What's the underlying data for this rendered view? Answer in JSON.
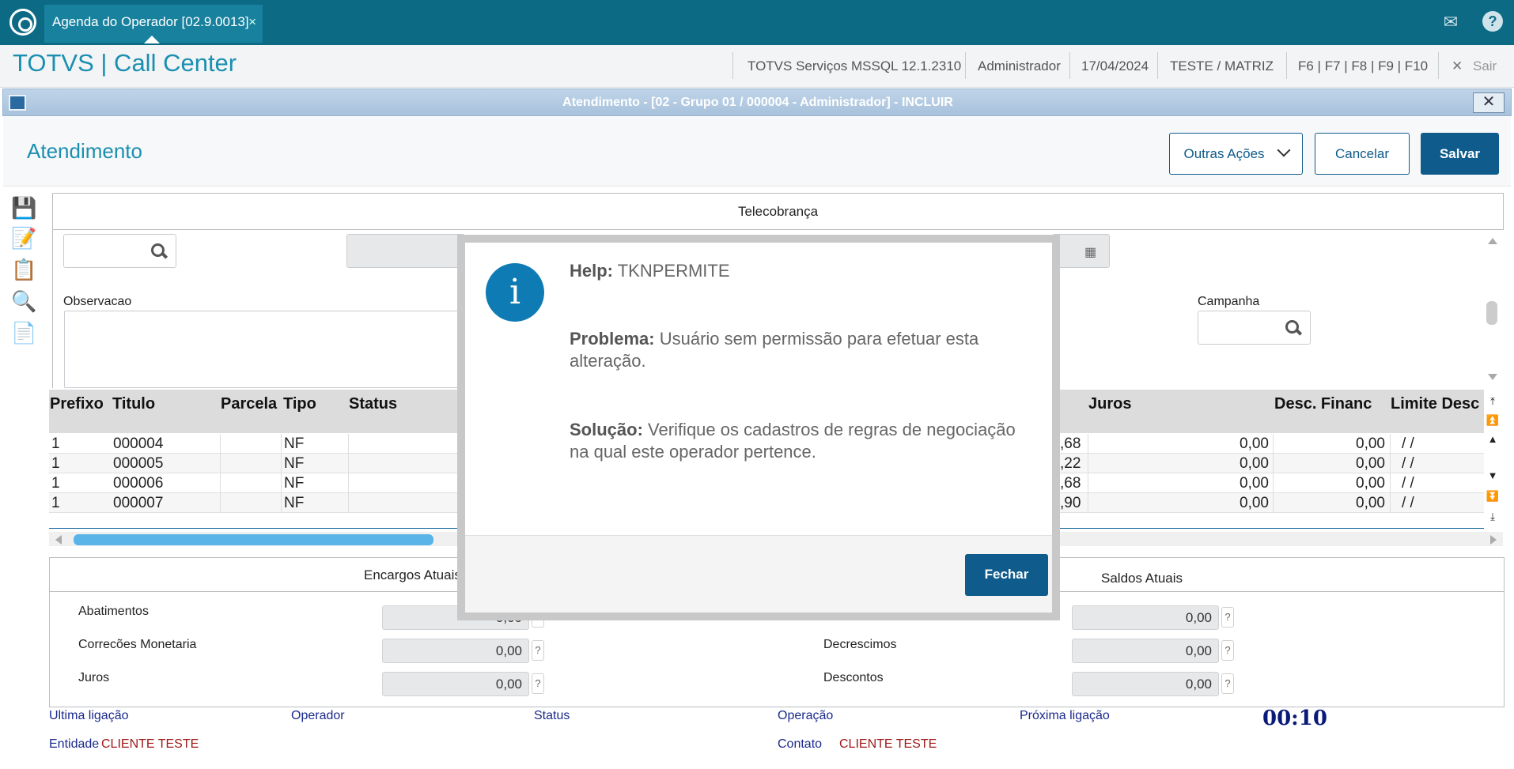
{
  "topbar": {
    "tab_label": "Agenda do Operador [02.9.0013]",
    "tab_close": "×",
    "mail_icon": "✉",
    "help_icon": "?"
  },
  "header": {
    "brand": "TOTVS | Call Center",
    "env": "TOTVS Serviços MSSQL 12.1.2310",
    "user": "Administrador",
    "date": "17/04/2024",
    "company": "TESTE / MATRIZ",
    "keys": "F6 | F7 | F8 | F9 | F10",
    "exit_icon": "✕",
    "exit_label": "Sair"
  },
  "window": {
    "title": "Atendimento - [02 - Grupo 01 / 000004 - Administrador] - INCLUIR",
    "close": "✕"
  },
  "page": {
    "title": "Atendimento",
    "other_actions": "Outras Ações",
    "cancel": "Cancelar",
    "save": "Salvar"
  },
  "panel": {
    "title": "Telecobrança",
    "observacao_label": "Observacao",
    "campanha_label": "Campanha"
  },
  "grid": {
    "headers": [
      "Prefixo",
      "Titulo",
      "Parcela",
      "Tipo",
      "Status",
      "Juros",
      "Desc. Financ",
      "Limite Desc"
    ],
    "rows": [
      {
        "prefixo": "1",
        "titulo": "000004",
        "tipo": "NF",
        "valor": ",68",
        "juros": "0,00",
        "desc": "0,00",
        "limite": "/ /"
      },
      {
        "prefixo": "1",
        "titulo": "000005",
        "tipo": "NF",
        "valor": ",22",
        "juros": "0,00",
        "desc": "0,00",
        "limite": "/ /"
      },
      {
        "prefixo": "1",
        "titulo": "000006",
        "tipo": "NF",
        "valor": ",68",
        "juros": "0,00",
        "desc": "0,00",
        "limite": "/ /"
      },
      {
        "prefixo": "1",
        "titulo": "000007",
        "tipo": "NF",
        "valor": ",90",
        "juros": "0,00",
        "desc": "0,00",
        "limite": "/ /"
      }
    ]
  },
  "bottom": {
    "encargos_tab": "Encargos Atuais",
    "saldos_tab": "Saldos Atuais",
    "left_fields": [
      {
        "label": "Abatimentos",
        "value": "0,00"
      },
      {
        "label": "Correcões Monetaria",
        "value": "0,00"
      },
      {
        "label": "Juros",
        "value": "0,00"
      }
    ],
    "right_fields": [
      {
        "label": "",
        "value": "0,00"
      },
      {
        "label": "Decrescimos",
        "value": "0,00"
      },
      {
        "label": "Descontos",
        "value": "0,00"
      }
    ],
    "qmark": "?"
  },
  "footer": {
    "ultima": "Ultima ligação",
    "operador": "Operador",
    "status": "Status",
    "operacao": "Operação",
    "proxima": "Próxima ligação",
    "timer": "00:10",
    "entidade_label": "Entidade",
    "entidade_value": "CLIENTE TESTE",
    "contato_label": "Contato",
    "contato_value": "CLIENTE TESTE"
  },
  "modal": {
    "icon": "i",
    "help_label": "Help:",
    "help_value": "TKNPERMITE",
    "problema_label": "Problema:",
    "problema_value": "Usuário sem permissão para efetuar esta alteração.",
    "solucao_label": "Solução:",
    "solucao_value": "Verifique os cadastros de regras de negociação na qual este operador pertence.",
    "close_button": "Fechar"
  }
}
